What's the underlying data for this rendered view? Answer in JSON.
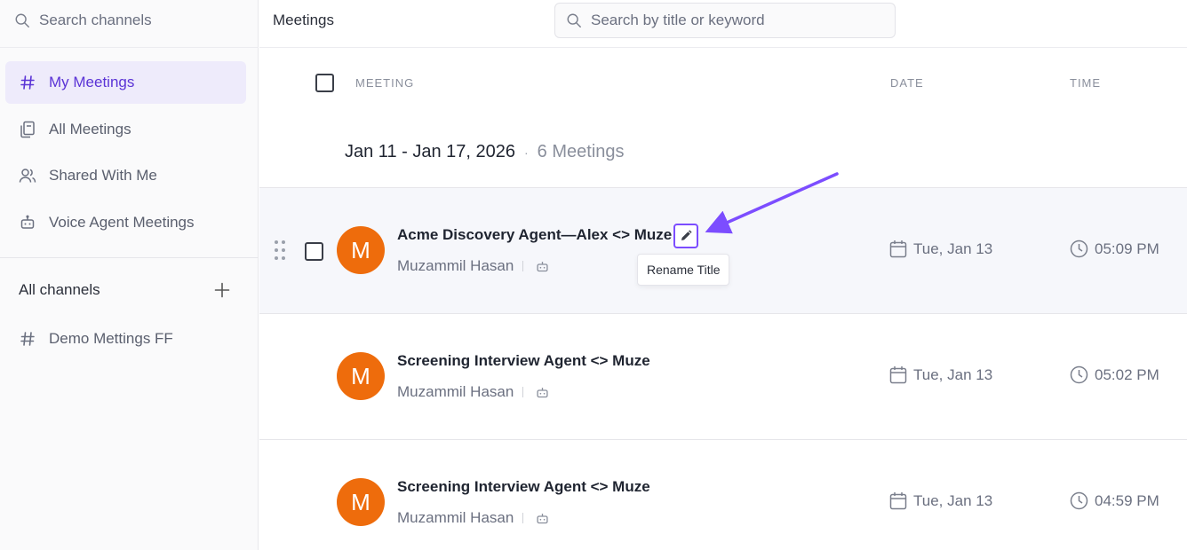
{
  "sidebar": {
    "search_placeholder": "Search channels",
    "items": [
      {
        "label": "My Meetings",
        "icon": "hash-icon",
        "active": true
      },
      {
        "label": "All Meetings",
        "icon": "documents-icon",
        "active": false
      },
      {
        "label": "Shared With Me",
        "icon": "users-icon",
        "active": false
      },
      {
        "label": "Voice Agent Meetings",
        "icon": "robot-icon",
        "active": false
      }
    ],
    "channels_label": "All channels",
    "channels": [
      {
        "label": "Demo Mettings FF",
        "icon": "hash-icon"
      }
    ]
  },
  "header": {
    "title": "Meetings",
    "search_placeholder": "Search by title or keyword"
  },
  "table": {
    "columns": {
      "meeting": "MEETING",
      "date": "DATE",
      "time": "TIME"
    },
    "group": {
      "range": "Jan 11 - Jan 17, 2026",
      "separator": "·",
      "count": "6 Meetings"
    },
    "rows": [
      {
        "title": "Acme Discovery Agent—Alex <> Muze",
        "owner": "Muzammil Hasan",
        "avatar": "M",
        "date": "Tue, Jan 13",
        "time": "05:09 PM"
      },
      {
        "title": "Screening Interview Agent <> Muze",
        "owner": "Muzammil Hasan",
        "avatar": "M",
        "date": "Tue, Jan 13",
        "time": "05:02 PM"
      },
      {
        "title": "Screening Interview Agent <> Muze",
        "owner": "Muzammil Hasan",
        "avatar": "M",
        "date": "Tue, Jan 13",
        "time": "04:59 PM"
      }
    ],
    "tooltip": "Rename Title"
  },
  "colors": {
    "accent": "#5b34d6",
    "active_bg": "#eeebfb",
    "avatar": "#ee6c0c",
    "highlight": "#7c4dff"
  }
}
